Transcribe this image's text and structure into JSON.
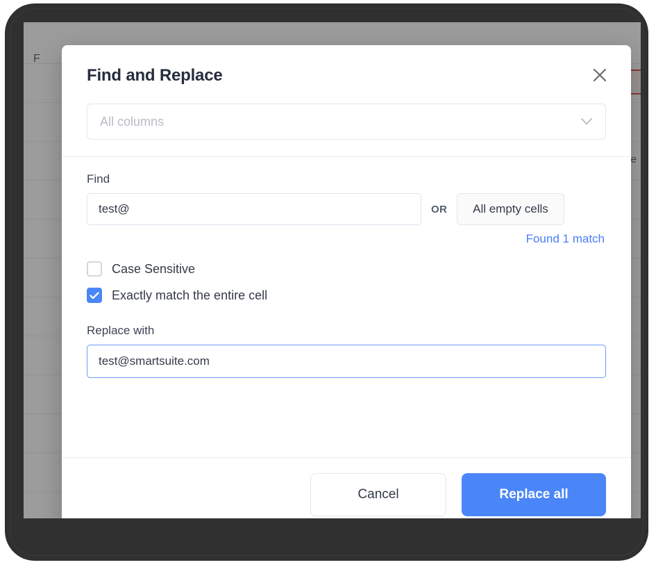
{
  "background_app": {
    "toolbar_text": "F",
    "grid_cell_text": "re",
    "rows": 12
  },
  "modal": {
    "title": "Find and Replace",
    "close_icon": "close-icon",
    "column_select": {
      "placeholder": "All columns",
      "value": "",
      "chevron_icon": "chevron-down-icon"
    },
    "find": {
      "label": "Find",
      "value": "test@",
      "placeholder": "",
      "or_label": "OR",
      "empty_cells_label": "All empty cells",
      "match_status": "Found 1 match"
    },
    "options": [
      {
        "label": "Case Sensitive",
        "checked": false
      },
      {
        "label": "Exactly match the entire cell",
        "checked": true
      }
    ],
    "replace": {
      "label": "Replace with",
      "value": "test@smartsuite.com",
      "placeholder": ""
    },
    "footer": {
      "cancel_label": "Cancel",
      "primary_label": "Replace all"
    }
  },
  "colors": {
    "accent_blue": "#4a86f7",
    "link_blue": "#4a7df8",
    "title_text": "#262d3d",
    "highlight_red": "#d93025",
    "frame_dark": "#303030"
  }
}
